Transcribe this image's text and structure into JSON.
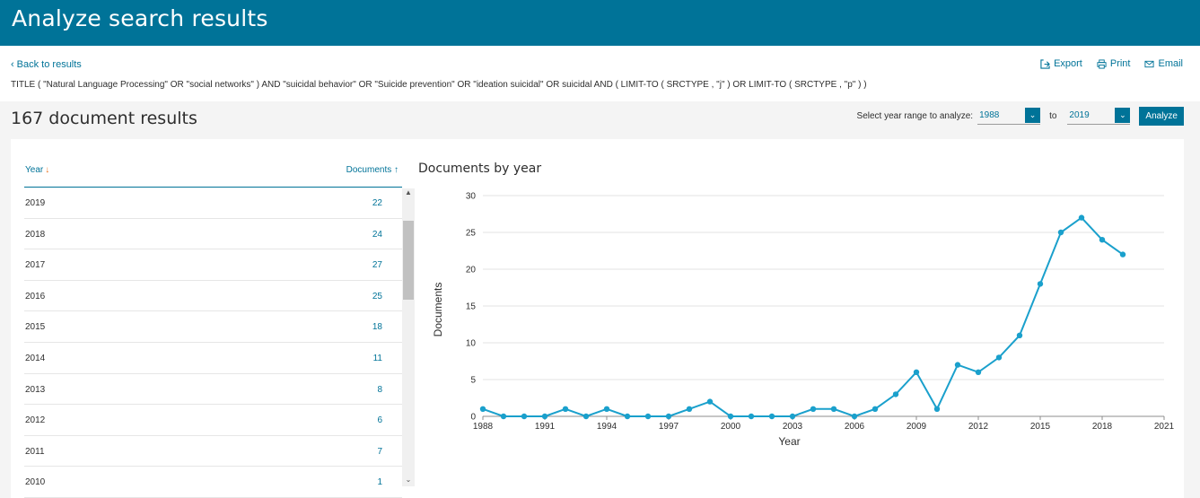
{
  "header": {
    "title": "Analyze search results"
  },
  "nav": {
    "back_label": "Back to results"
  },
  "actions": {
    "export": "Export",
    "print": "Print",
    "email": "Email"
  },
  "query": "TITLE ( \"Natural Language Processing\"  OR  \"social networks\" )  AND  \"suicidal behavior\"  OR  \"Suicide prevention\"  OR  \"ideation suicidal\"  OR  suicidal  AND  ( LIMIT-TO ( SRCTYPE ,  \"j\" )  OR  LIMIT-TO ( SRCTYPE ,  \"p\" ) )",
  "results": {
    "title": "167 document results"
  },
  "range": {
    "label": "Select year range to analyze:",
    "from": "1988",
    "to_label": "to",
    "to": "2019",
    "button": "Analyze"
  },
  "table": {
    "col_year": "Year",
    "col_docs": "Documents",
    "rows": [
      {
        "year": "2019",
        "count": "22"
      },
      {
        "year": "2018",
        "count": "24"
      },
      {
        "year": "2017",
        "count": "27"
      },
      {
        "year": "2016",
        "count": "25"
      },
      {
        "year": "2015",
        "count": "18"
      },
      {
        "year": "2014",
        "count": "11"
      },
      {
        "year": "2013",
        "count": "8"
      },
      {
        "year": "2012",
        "count": "6"
      },
      {
        "year": "2011",
        "count": "7"
      },
      {
        "year": "2010",
        "count": "1"
      }
    ]
  },
  "colors": {
    "brand": "#007398",
    "line": "#1aa0cc",
    "sort_arrow": "#e9711c"
  },
  "chart_data": {
    "type": "line",
    "title": "Documents by year",
    "xlabel": "Year",
    "ylabel": "Documents",
    "xlim": [
      1988,
      2021
    ],
    "ylim": [
      0,
      30
    ],
    "xticks": [
      1988,
      1991,
      1994,
      1997,
      2000,
      2003,
      2006,
      2009,
      2012,
      2015,
      2018,
      2021
    ],
    "yticks": [
      0,
      5,
      10,
      15,
      20,
      25,
      30
    ],
    "grid": true,
    "x": [
      1988,
      1989,
      1990,
      1991,
      1992,
      1993,
      1994,
      1995,
      1996,
      1997,
      1998,
      1999,
      2000,
      2001,
      2002,
      2003,
      2004,
      2005,
      2006,
      2007,
      2008,
      2009,
      2010,
      2011,
      2012,
      2013,
      2014,
      2015,
      2016,
      2017,
      2018,
      2019
    ],
    "y": [
      1,
      0,
      0,
      0,
      1,
      0,
      1,
      0,
      0,
      0,
      1,
      2,
      0,
      0,
      0,
      0,
      1,
      1,
      0,
      1,
      3,
      6,
      1,
      7,
      6,
      8,
      11,
      18,
      25,
      27,
      24,
      22
    ]
  }
}
